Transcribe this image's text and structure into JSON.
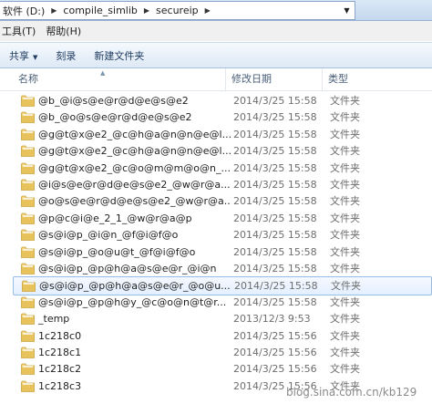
{
  "address": {
    "crumbs": [
      "软件 (D:)",
      "compile_simlib",
      "secureip"
    ]
  },
  "menu": [
    "工具(T)",
    "帮助(H)"
  ],
  "toolbar": {
    "share": "共享",
    "burn": "刻录",
    "new_folder": "新建文件夹"
  },
  "columns": {
    "name": "名称",
    "date": "修改日期",
    "type": "类型"
  },
  "files": [
    {
      "name": "@b_@i@s@e@r@d@e@s@e2",
      "date": "2014/3/25 15:58",
      "type": "文件夹"
    },
    {
      "name": "@b_@o@s@e@r@d@e@s@e2",
      "date": "2014/3/25 15:58",
      "type": "文件夹"
    },
    {
      "name": "@g@t@x@e2_@c@h@a@n@n@e@l...",
      "date": "2014/3/25 15:58",
      "type": "文件夹"
    },
    {
      "name": "@g@t@x@e2_@c@h@a@n@n@e@l...",
      "date": "2014/3/25 15:58",
      "type": "文件夹"
    },
    {
      "name": "@g@t@x@e2_@c@o@m@m@o@n_...",
      "date": "2014/3/25 15:58",
      "type": "文件夹"
    },
    {
      "name": "@i@s@e@r@d@e@s@e2_@w@r@a...",
      "date": "2014/3/25 15:58",
      "type": "文件夹"
    },
    {
      "name": "@o@s@e@r@d@e@s@e2_@w@r@a...",
      "date": "2014/3/25 15:58",
      "type": "文件夹"
    },
    {
      "name": "@p@c@i@e_2_1_@w@r@a@p",
      "date": "2014/3/25 15:58",
      "type": "文件夹"
    },
    {
      "name": "@s@i@p_@i@n_@f@i@f@o",
      "date": "2014/3/25 15:58",
      "type": "文件夹"
    },
    {
      "name": "@s@i@p_@o@u@t_@f@i@f@o",
      "date": "2014/3/25 15:58",
      "type": "文件夹"
    },
    {
      "name": "@s@i@p_@p@h@a@s@e@r_@i@n",
      "date": "2014/3/25 15:58",
      "type": "文件夹"
    },
    {
      "name": "@s@i@p_@p@h@a@s@e@r_@o@u...",
      "date": "2014/3/25 15:58",
      "type": "文件夹"
    },
    {
      "name": "@s@i@p_@p@h@y_@c@o@n@t@r...",
      "date": "2014/3/25 15:58",
      "type": "文件夹"
    },
    {
      "name": "_temp",
      "date": "2013/12/3 9:53",
      "type": "文件夹"
    },
    {
      "name": "1c218c0",
      "date": "2014/3/25 15:56",
      "type": "文件夹"
    },
    {
      "name": "1c218c1",
      "date": "2014/3/25 15:56",
      "type": "文件夹"
    },
    {
      "name": "1c218c2",
      "date": "2014/3/25 15:56",
      "type": "文件夹"
    },
    {
      "name": "1c218c3",
      "date": "2014/3/25 15:56",
      "type": "文件夹"
    }
  ],
  "selected_index": 11,
  "watermark": "blog.sina.com.cn/kb129",
  "colors": {
    "folder": "#e8c25a",
    "selection": "#cce8ff",
    "toolbar": "#dde9f6"
  }
}
